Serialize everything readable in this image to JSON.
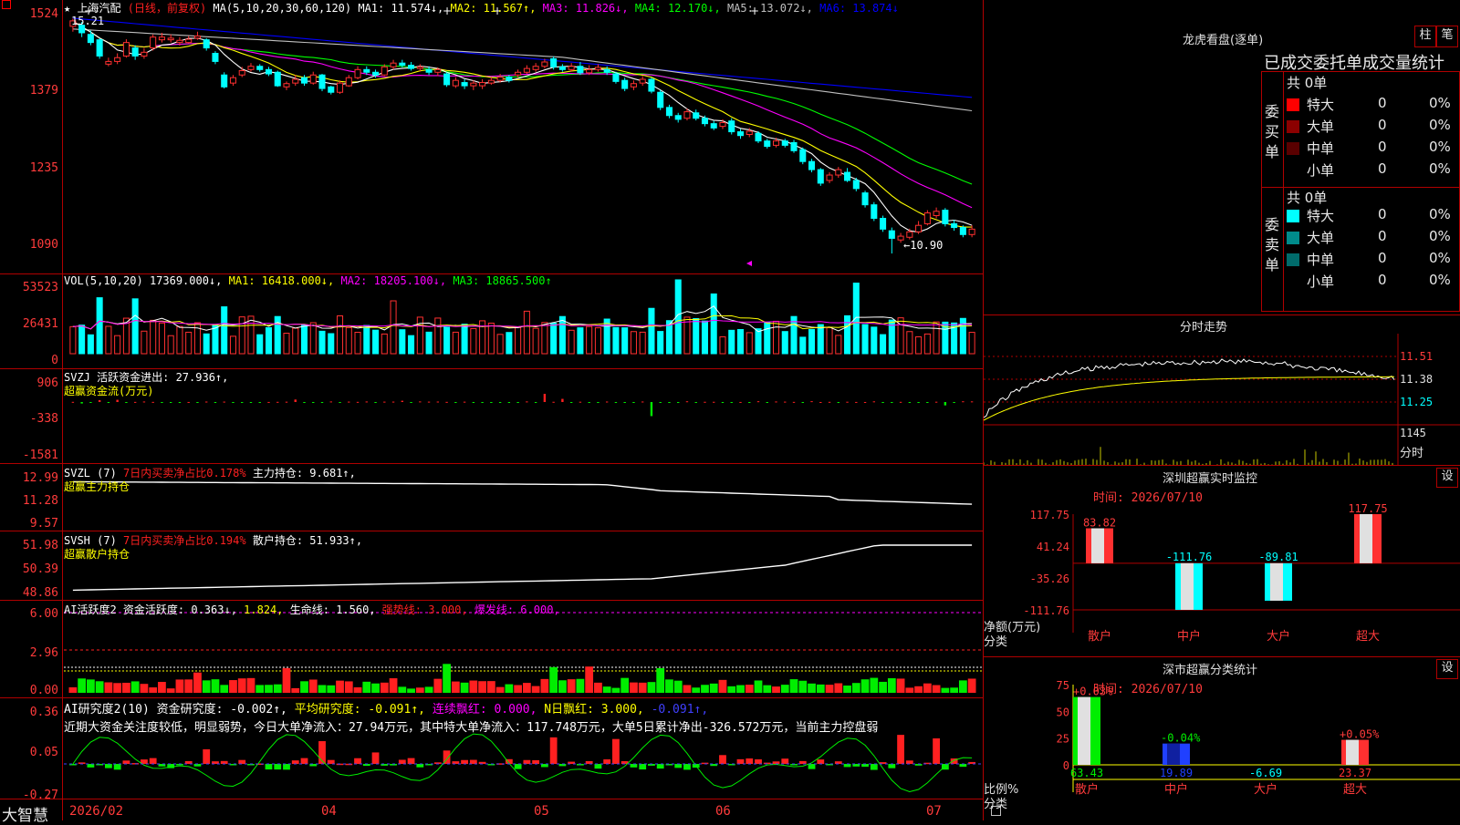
{
  "left_title": "上海汽配",
  "left_title_mode": "(日线，前复权)",
  "kline_legend": {
    "ma_def": "MA(5,10,20,30,60,120)",
    "items": [
      {
        "text": "MA1: 11.574↓,",
        "color": "#ffffff"
      },
      {
        "text": "MA2: 11.567↑,",
        "color": "#ffff00"
      },
      {
        "text": "MA3: 11.826↓,",
        "color": "#ff00ff"
      },
      {
        "text": "MA4: 12.170↓,",
        "color": "#00ff00"
      },
      {
        "text": "MA5: 13.072↓,",
        "color": "#c0c0c0"
      },
      {
        "text": "MA6: 13.874↓",
        "color": "#0000ff"
      }
    ],
    "price_labels": [
      "1524",
      "1379",
      "1235",
      "1090"
    ],
    "high_mark": "15.21",
    "low_mark": "←10.90",
    "candles": [
      {
        "o": 15.1,
        "c": 15.2,
        "h": 15.24,
        "l": 15.0
      },
      {
        "o": 15.12,
        "c": 14.98,
        "h": 15.18,
        "l": 14.9
      },
      {
        "o": 14.95,
        "c": 14.8,
        "h": 15.02,
        "l": 14.75
      },
      {
        "o": 14.85,
        "c": 14.55,
        "h": 14.88,
        "l": 14.5
      },
      {
        "o": 14.4,
        "c": 14.45,
        "h": 14.52,
        "l": 14.36
      },
      {
        "o": 14.45,
        "c": 14.52,
        "h": 14.6,
        "l": 14.4
      },
      {
        "o": 14.55,
        "c": 14.8,
        "h": 14.86,
        "l": 14.52
      },
      {
        "o": 14.7,
        "c": 14.55,
        "h": 14.75,
        "l": 14.48
      },
      {
        "o": 14.55,
        "c": 14.62,
        "h": 14.7,
        "l": 14.5
      },
      {
        "o": 14.7,
        "c": 14.9,
        "h": 14.95,
        "l": 14.65
      },
      {
        "o": 14.85,
        "c": 14.9,
        "h": 14.98,
        "l": 14.8
      },
      {
        "o": 14.85,
        "c": 14.88,
        "h": 14.95,
        "l": 14.8
      },
      {
        "o": 14.8,
        "c": 14.84,
        "h": 14.9,
        "l": 14.74
      },
      {
        "o": 14.8,
        "c": 14.86,
        "h": 14.92,
        "l": 14.78
      },
      {
        "o": 14.88,
        "c": 14.92,
        "h": 15.0,
        "l": 14.85
      },
      {
        "o": 14.85,
        "c": 14.7,
        "h": 14.88,
        "l": 14.65
      },
      {
        "o": 14.6,
        "c": 14.45,
        "h": 14.64,
        "l": 14.4
      },
      {
        "o": 14.2,
        "c": 13.98,
        "h": 14.25,
        "l": 13.95
      },
      {
        "o": 14.05,
        "c": 14.15,
        "h": 14.2,
        "l": 14.0
      },
      {
        "o": 14.2,
        "c": 14.28,
        "h": 14.35,
        "l": 14.16
      },
      {
        "o": 14.3,
        "c": 14.36,
        "h": 14.42,
        "l": 14.26
      },
      {
        "o": 14.36,
        "c": 14.3,
        "h": 14.4,
        "l": 14.26
      },
      {
        "o": 14.3,
        "c": 14.22,
        "h": 14.35,
        "l": 14.18
      },
      {
        "o": 14.25,
        "c": 14.0,
        "h": 14.28,
        "l": 13.98
      },
      {
        "o": 13.98,
        "c": 14.04,
        "h": 14.08,
        "l": 13.92
      },
      {
        "o": 14.05,
        "c": 14.12,
        "h": 14.2,
        "l": 14.0
      },
      {
        "o": 14.15,
        "c": 14.05,
        "h": 14.2,
        "l": 14.0
      },
      {
        "o": 14.05,
        "c": 14.2,
        "h": 14.26,
        "l": 14.02
      },
      {
        "o": 14.2,
        "c": 13.95,
        "h": 14.22,
        "l": 13.9
      },
      {
        "o": 13.98,
        "c": 13.88,
        "h": 14.0,
        "l": 13.84
      },
      {
        "o": 13.88,
        "c": 14.05,
        "h": 14.1,
        "l": 13.85
      },
      {
        "o": 14.0,
        "c": 14.15,
        "h": 14.2,
        "l": 13.98
      },
      {
        "o": 14.15,
        "c": 14.3,
        "h": 14.36,
        "l": 14.12
      },
      {
        "o": 14.3,
        "c": 14.25,
        "h": 14.36,
        "l": 14.2
      },
      {
        "o": 14.25,
        "c": 14.2,
        "h": 14.3,
        "l": 14.15
      },
      {
        "o": 14.2,
        "c": 14.35,
        "h": 14.4,
        "l": 14.18
      },
      {
        "o": 14.35,
        "c": 14.42,
        "h": 14.48,
        "l": 14.3
      },
      {
        "o": 14.42,
        "c": 14.38,
        "h": 14.48,
        "l": 14.34
      },
      {
        "o": 14.38,
        "c": 14.32,
        "h": 14.44,
        "l": 14.28
      },
      {
        "o": 14.32,
        "c": 14.35,
        "h": 14.4,
        "l": 14.26
      },
      {
        "o": 14.3,
        "c": 14.25,
        "h": 14.36,
        "l": 14.2
      },
      {
        "o": 14.25,
        "c": 14.3,
        "h": 14.34,
        "l": 14.18
      },
      {
        "o": 14.22,
        "c": 14.02,
        "h": 14.25,
        "l": 13.98
      },
      {
        "o": 14.0,
        "c": 14.1,
        "h": 14.16,
        "l": 13.96
      },
      {
        "o": 14.06,
        "c": 14.0,
        "h": 14.12,
        "l": 13.94
      },
      {
        "o": 14.0,
        "c": 14.05,
        "h": 14.1,
        "l": 13.92
      },
      {
        "o": 14.0,
        "c": 14.06,
        "h": 14.12,
        "l": 13.94
      },
      {
        "o": 14.05,
        "c": 14.1,
        "h": 14.16,
        "l": 14.02
      },
      {
        "o": 14.1,
        "c": 14.16,
        "h": 14.22,
        "l": 14.06
      },
      {
        "o": 14.16,
        "c": 14.1,
        "h": 14.2,
        "l": 14.06
      },
      {
        "o": 14.2,
        "c": 14.25,
        "h": 14.3,
        "l": 14.15
      },
      {
        "o": 14.25,
        "c": 14.32,
        "h": 14.38,
        "l": 14.22
      },
      {
        "o": 14.3,
        "c": 14.36,
        "h": 14.42,
        "l": 14.26
      },
      {
        "o": 14.36,
        "c": 14.44,
        "h": 14.5,
        "l": 14.32
      },
      {
        "o": 14.5,
        "c": 14.35,
        "h": 14.54,
        "l": 14.3
      },
      {
        "o": 14.35,
        "c": 14.3,
        "h": 14.4,
        "l": 14.26
      },
      {
        "o": 14.3,
        "c": 14.36,
        "h": 14.42,
        "l": 14.26
      },
      {
        "o": 14.36,
        "c": 14.24,
        "h": 14.44,
        "l": 14.2
      },
      {
        "o": 14.24,
        "c": 14.3,
        "h": 14.38,
        "l": 14.2
      },
      {
        "o": 14.3,
        "c": 14.34,
        "h": 14.4,
        "l": 14.26
      },
      {
        "o": 14.3,
        "c": 14.25,
        "h": 14.36,
        "l": 14.2
      },
      {
        "o": 14.22,
        "c": 14.08,
        "h": 14.26,
        "l": 14.04
      },
      {
        "o": 14.1,
        "c": 13.95,
        "h": 14.15,
        "l": 13.9
      },
      {
        "o": 13.98,
        "c": 14.04,
        "h": 14.1,
        "l": 13.92
      },
      {
        "o": 14.05,
        "c": 14.12,
        "h": 14.18,
        "l": 14.0
      },
      {
        "o": 14.12,
        "c": 13.9,
        "h": 14.15,
        "l": 13.86
      },
      {
        "o": 13.88,
        "c": 13.6,
        "h": 13.92,
        "l": 13.55
      },
      {
        "o": 13.6,
        "c": 13.45,
        "h": 13.65,
        "l": 13.4
      },
      {
        "o": 13.45,
        "c": 13.38,
        "h": 13.5,
        "l": 13.32
      },
      {
        "o": 13.4,
        "c": 13.52,
        "h": 13.58,
        "l": 13.36
      },
      {
        "o": 13.5,
        "c": 13.4,
        "h": 13.56,
        "l": 13.36
      },
      {
        "o": 13.4,
        "c": 13.3,
        "h": 13.45,
        "l": 13.25
      },
      {
        "o": 13.3,
        "c": 13.22,
        "h": 13.35,
        "l": 13.18
      },
      {
        "o": 13.25,
        "c": 13.32,
        "h": 13.38,
        "l": 13.2
      },
      {
        "o": 13.35,
        "c": 13.15,
        "h": 13.4,
        "l": 13.1
      },
      {
        "o": 13.15,
        "c": 13.08,
        "h": 13.2,
        "l": 13.02
      },
      {
        "o": 13.1,
        "c": 13.16,
        "h": 13.22,
        "l": 13.05
      },
      {
        "o": 13.12,
        "c": 12.98,
        "h": 13.16,
        "l": 12.94
      },
      {
        "o": 12.98,
        "c": 12.88,
        "h": 13.02,
        "l": 12.84
      },
      {
        "o": 12.9,
        "c": 12.98,
        "h": 13.04,
        "l": 12.86
      },
      {
        "o": 12.98,
        "c": 12.9,
        "h": 13.02,
        "l": 12.86
      },
      {
        "o": 12.95,
        "c": 12.8,
        "h": 13.0,
        "l": 12.76
      },
      {
        "o": 12.82,
        "c": 12.6,
        "h": 12.86,
        "l": 12.55
      },
      {
        "o": 12.6,
        "c": 12.45,
        "h": 12.65,
        "l": 12.4
      },
      {
        "o": 12.45,
        "c": 12.2,
        "h": 12.48,
        "l": 12.15
      },
      {
        "o": 12.25,
        "c": 12.35,
        "h": 12.4,
        "l": 12.2
      },
      {
        "o": 12.35,
        "c": 12.45,
        "h": 12.5,
        "l": 12.3
      },
      {
        "o": 12.4,
        "c": 12.25,
        "h": 12.48,
        "l": 12.22
      },
      {
        "o": 12.25,
        "c": 12.1,
        "h": 12.3,
        "l": 12.05
      },
      {
        "o": 12.02,
        "c": 11.8,
        "h": 12.06,
        "l": 11.75
      },
      {
        "o": 11.8,
        "c": 11.55,
        "h": 11.85,
        "l": 11.5
      },
      {
        "o": 11.55,
        "c": 11.35,
        "h": 11.6,
        "l": 11.3
      },
      {
        "o": 11.32,
        "c": 11.18,
        "h": 11.38,
        "l": 10.9
      },
      {
        "o": 11.15,
        "c": 11.22,
        "h": 11.28,
        "l": 11.1
      },
      {
        "o": 11.2,
        "c": 11.3,
        "h": 11.36,
        "l": 11.16
      },
      {
        "o": 11.3,
        "c": 11.42,
        "h": 11.5,
        "l": 11.26
      },
      {
        "o": 11.45,
        "c": 11.65,
        "h": 11.7,
        "l": 11.42
      },
      {
        "o": 11.6,
        "c": 11.68,
        "h": 11.75,
        "l": 11.55
      },
      {
        "o": 11.7,
        "c": 11.45,
        "h": 11.74,
        "l": 11.4
      },
      {
        "o": 11.45,
        "c": 11.38,
        "h": 11.52,
        "l": 11.32
      },
      {
        "o": 11.38,
        "c": 11.25,
        "h": 11.42,
        "l": 11.2
      },
      {
        "o": 11.25,
        "c": 11.35,
        "h": 11.42,
        "l": 11.2
      }
    ]
  },
  "vol_legend": {
    "def": "VOL(5,10,20)",
    "items": [
      {
        "text": "17369.000↓,",
        "color": "#ffffff"
      },
      {
        "text": "MA1: 16418.000↓,",
        "color": "#ffff00"
      },
      {
        "text": "MA2: 18205.100↓,",
        "color": "#ff00ff"
      },
      {
        "text": "MA3: 18865.500↑",
        "color": "#00ff00"
      }
    ],
    "labels": [
      "53523",
      "26431",
      "0"
    ]
  },
  "svzj": {
    "line1": "SVZJ  活跃资金进出: 27.936↑,",
    "line2": "超赢资金流(万元)",
    "labels": [
      "906",
      "-338",
      "-1581"
    ]
  },
  "svzl": {
    "def": "SVZL (7)",
    "ratio": "7日内买卖净占比0.178%",
    "value": "主力持仓: 9.681↑,",
    "name": "超赢主力持仓",
    "labels": [
      "12.99",
      "11.28",
      "9.57"
    ]
  },
  "svsh": {
    "def": "SVSH (7)",
    "ratio": "7日内买卖净占比0.194%",
    "value": "散户持仓: 51.933↑,",
    "name": "超赢散户持仓",
    "labels": [
      "51.98",
      "50.39",
      "48.86"
    ]
  },
  "ai1": {
    "items": [
      {
        "text": "AI活跃度2 资金活跃度: 0.363↓,",
        "color": "#ffffff"
      },
      {
        "text": "1.824,",
        "color": "#ffff00"
      },
      {
        "text": "生命线: 1.560,",
        "color": "#ffffff"
      },
      {
        "text": "强势线: 3.000,",
        "color": "#ff0000"
      },
      {
        "text": "爆发线: 6.000,",
        "color": "#ff00ff"
      }
    ],
    "labels": [
      "6.00",
      "2.96",
      "0.00"
    ]
  },
  "ai2": {
    "items": [
      {
        "text": "AI研究度2(10) 资金研究度: -0.002↑,",
        "color": "#ffffff"
      },
      {
        "text": "平均研究度: -0.091↑,",
        "color": "#ffff00"
      },
      {
        "text": "连续飘红: 0.000,",
        "color": "#ff00ff"
      },
      {
        "text": "N日飘红: 3.000,",
        "color": "#ffff00"
      },
      {
        "text": "-0.091↑,",
        "color": "#4040ff"
      }
    ],
    "note": "近期大资金关注度较低，明显弱势，今日大单净流入：27.94万元，其中特大单净流入：117.748万元，大单5日累计净出-326.572万元，当前主力控盘弱",
    "labels": [
      "0.36",
      "0.05",
      "-0.27"
    ]
  },
  "bottom_bar": {
    "brand": "大智慧",
    "dates": [
      "2026/02",
      "04",
      "05",
      "06",
      "07"
    ]
  },
  "dragon": {
    "title": "龙虎看盘(逐单)",
    "btn1": "柱",
    "btn2": "笔",
    "subtitle": "已成交委托单成交量统计",
    "buy": {
      "label": "委\n买\n单",
      "total": "共 0单",
      "rows": [
        {
          "name": "特大",
          "count": "0",
          "pct": "0%",
          "color": "#ff0000"
        },
        {
          "name": "大单",
          "count": "0",
          "pct": "0%",
          "color": "#8b0000"
        },
        {
          "name": "中单",
          "count": "0",
          "pct": "0%",
          "color": "#5a0000"
        },
        {
          "name": "小单",
          "count": "0",
          "pct": "0%",
          "color": "#000000"
        }
      ]
    },
    "sell": {
      "label": "委\n卖\n单",
      "total": "共 0单",
      "rows": [
        {
          "name": "特大",
          "count": "0",
          "pct": "0%",
          "color": "#00ffff"
        },
        {
          "name": "大单",
          "count": "0",
          "pct": "0%",
          "color": "#008b8b"
        },
        {
          "name": "中单",
          "count": "0",
          "pct": "0%",
          "color": "#006b6b"
        },
        {
          "name": "小单",
          "count": "0",
          "pct": "0%",
          "color": "#000000"
        }
      ]
    }
  },
  "intraday": {
    "title": "分时走势",
    "labels": [
      "11.51",
      "11.38",
      "11.25",
      "1145",
      "分时"
    ]
  },
  "sz_monitor": {
    "title": "深圳超赢实时监控",
    "btn": "设",
    "time": "时间: 2026/07/10",
    "ylabels": [
      "117.75",
      "41.24",
      "-35.26",
      "-111.76"
    ],
    "ytitle1": "净额(万元)",
    "ytitle2": "分类",
    "bars": [
      {
        "cat": "散户",
        "value": 83.82,
        "label": "83.82"
      },
      {
        "cat": "中户",
        "value": -111.76,
        "label": "-111.76"
      },
      {
        "cat": "大户",
        "value": -89.81,
        "label": "-89.81"
      },
      {
        "cat": "超大",
        "value": 117.75,
        "label": "117.75"
      }
    ]
  },
  "sz_stats": {
    "title": "深市超赢分类统计",
    "btn": "设",
    "time": "时间: 2026/07/10",
    "ylabels": [
      "75",
      "50",
      "25",
      "0"
    ],
    "ytitle1": "比例%",
    "ytitle2": "分类",
    "bars": [
      {
        "cat": "散户",
        "value": 63.43,
        "top": "+0.03%",
        "bottom": "63.43"
      },
      {
        "cat": "中户",
        "value": 19.89,
        "top": "-0.04%",
        "bottom": "19.89"
      },
      {
        "cat": "大户",
        "value": 0,
        "top": "",
        "bottom": "-6.69"
      },
      {
        "cat": "超大",
        "value": 23.37,
        "top": "+0.05%",
        "bottom": "23.37"
      }
    ]
  }
}
